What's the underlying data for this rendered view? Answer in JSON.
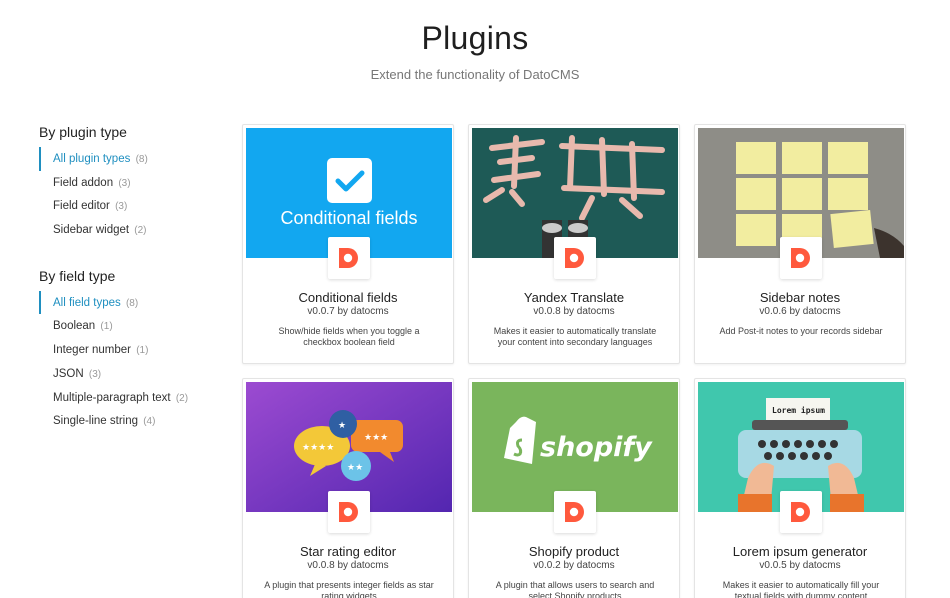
{
  "header": {
    "title": "Plugins",
    "subtitle": "Extend the functionality of DatoCMS"
  },
  "filters": {
    "plugin_type": {
      "heading": "By plugin type",
      "items": [
        {
          "label": "All plugin types",
          "count": "(8)",
          "active": true
        },
        {
          "label": "Field addon",
          "count": "(3)",
          "active": false
        },
        {
          "label": "Field editor",
          "count": "(3)",
          "active": false
        },
        {
          "label": "Sidebar widget",
          "count": "(2)",
          "active": false
        }
      ]
    },
    "field_type": {
      "heading": "By field type",
      "items": [
        {
          "label": "All field types",
          "count": "(8)",
          "active": true
        },
        {
          "label": "Boolean",
          "count": "(1)",
          "active": false
        },
        {
          "label": "Integer number",
          "count": "(1)",
          "active": false
        },
        {
          "label": "JSON",
          "count": "(3)",
          "active": false
        },
        {
          "label": "Multiple-paragraph text",
          "count": "(2)",
          "active": false
        },
        {
          "label": "Single-line string",
          "count": "(4)",
          "active": false
        }
      ]
    }
  },
  "plugins": [
    {
      "title": "Conditional fields",
      "version": "v0.0.7 by datocms",
      "description": "Show/hide fields when you toggle a checkbox boolean field",
      "image_text": "Conditional fields"
    },
    {
      "title": "Yandex Translate",
      "version": "v0.0.8 by datocms",
      "description": "Makes it easier to automatically translate your content into secondary languages"
    },
    {
      "title": "Sidebar notes",
      "version": "v0.0.6 by datocms",
      "description": "Add Post-it notes to your records sidebar"
    },
    {
      "title": "Star rating editor",
      "version": "v0.0.8 by datocms",
      "description": "A plugin that presents integer fields as star rating widgets"
    },
    {
      "title": "Shopify product",
      "version": "v0.0.2 by datocms",
      "description": "A plugin that allows users to search and select Shopify products",
      "image_text": "shopify"
    },
    {
      "title": "Lorem ipsum generator",
      "version": "v0.0.5 by datocms",
      "description": "Makes it easier to automatically fill your textual fields with dummy content",
      "image_text": "Lorem ipsum"
    }
  ],
  "colors": {
    "accent": "#1f8fc0",
    "datocms_logo": "#ff593d",
    "conditional_bg": "#12a7f0",
    "shopify_bg": "#7ab55c",
    "lorem_bg": "#40c7ad"
  }
}
